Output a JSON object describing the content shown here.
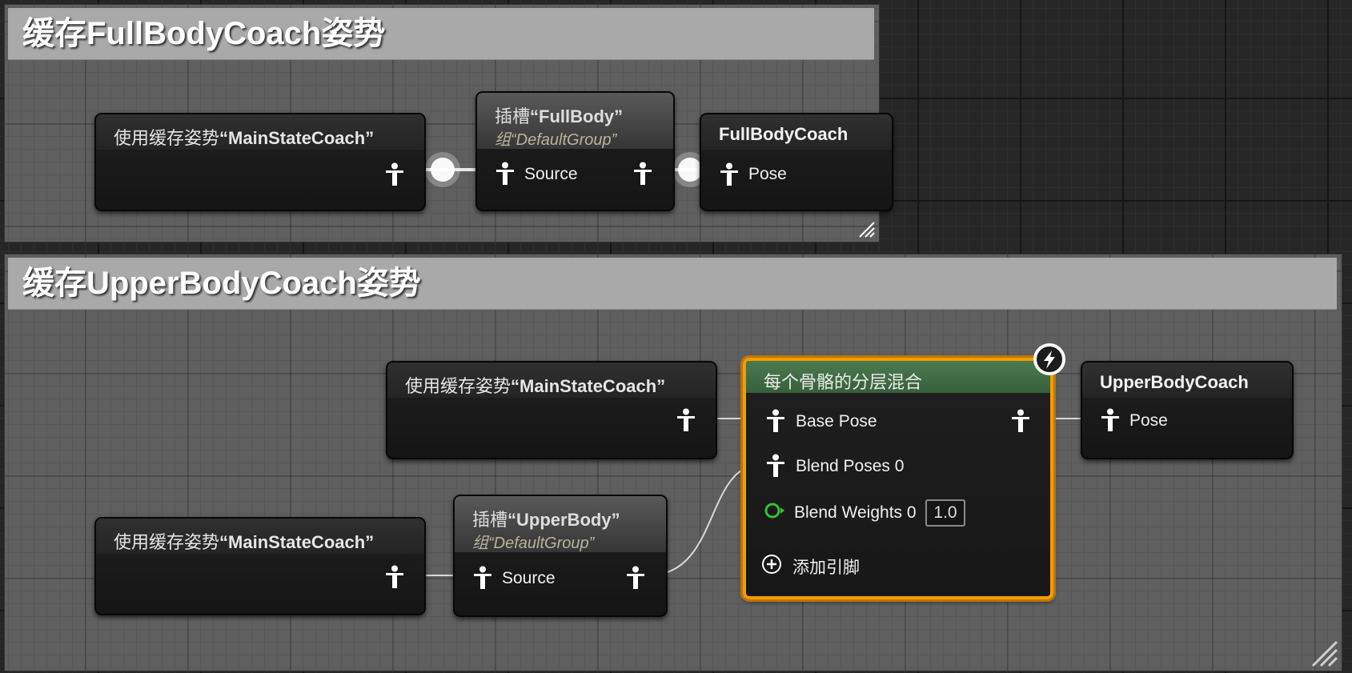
{
  "comments": {
    "top": {
      "title": "缓存FullBodyCoach姿势"
    },
    "bottom": {
      "title": "缓存UpperBodyCoach姿势"
    }
  },
  "nodes": {
    "use_cached_1": {
      "prefix": "使用缓存姿势",
      "name": "“MainStateCoach”"
    },
    "slot_1": {
      "prefix": "插槽",
      "name": "“FullBody”",
      "group": "组“DefaultGroup”",
      "pin_source": "Source"
    },
    "save_1": {
      "title": "FullBodyCoach",
      "pin_pose": "Pose"
    },
    "use_cached_2": {
      "prefix": "使用缓存姿势",
      "name": "“MainStateCoach”"
    },
    "use_cached_3": {
      "prefix": "使用缓存姿势",
      "name": "“MainStateCoach”"
    },
    "slot_2": {
      "prefix": "插槽",
      "name": "“UpperBody”",
      "group": "组“DefaultGroup”",
      "pin_source": "Source"
    },
    "layered_blend": {
      "title": "每个骨骼的分层混合",
      "pin_base_pose": "Base Pose",
      "pin_blend_poses": "Blend Poses 0",
      "pin_blend_weights": "Blend Weights 0",
      "blend_weight_value": "1.0",
      "add_pin": "添加引脚"
    },
    "save_2": {
      "title": "UpperBodyCoach",
      "pin_pose": "Pose"
    }
  },
  "colors": {
    "graph_bg": "#262626",
    "comment_bg": "#5f5f5f",
    "comment_header": "#a9a9a9",
    "selection": "#f59c00",
    "blend_header": "#4c7a50",
    "float_pin": "#35c235"
  }
}
